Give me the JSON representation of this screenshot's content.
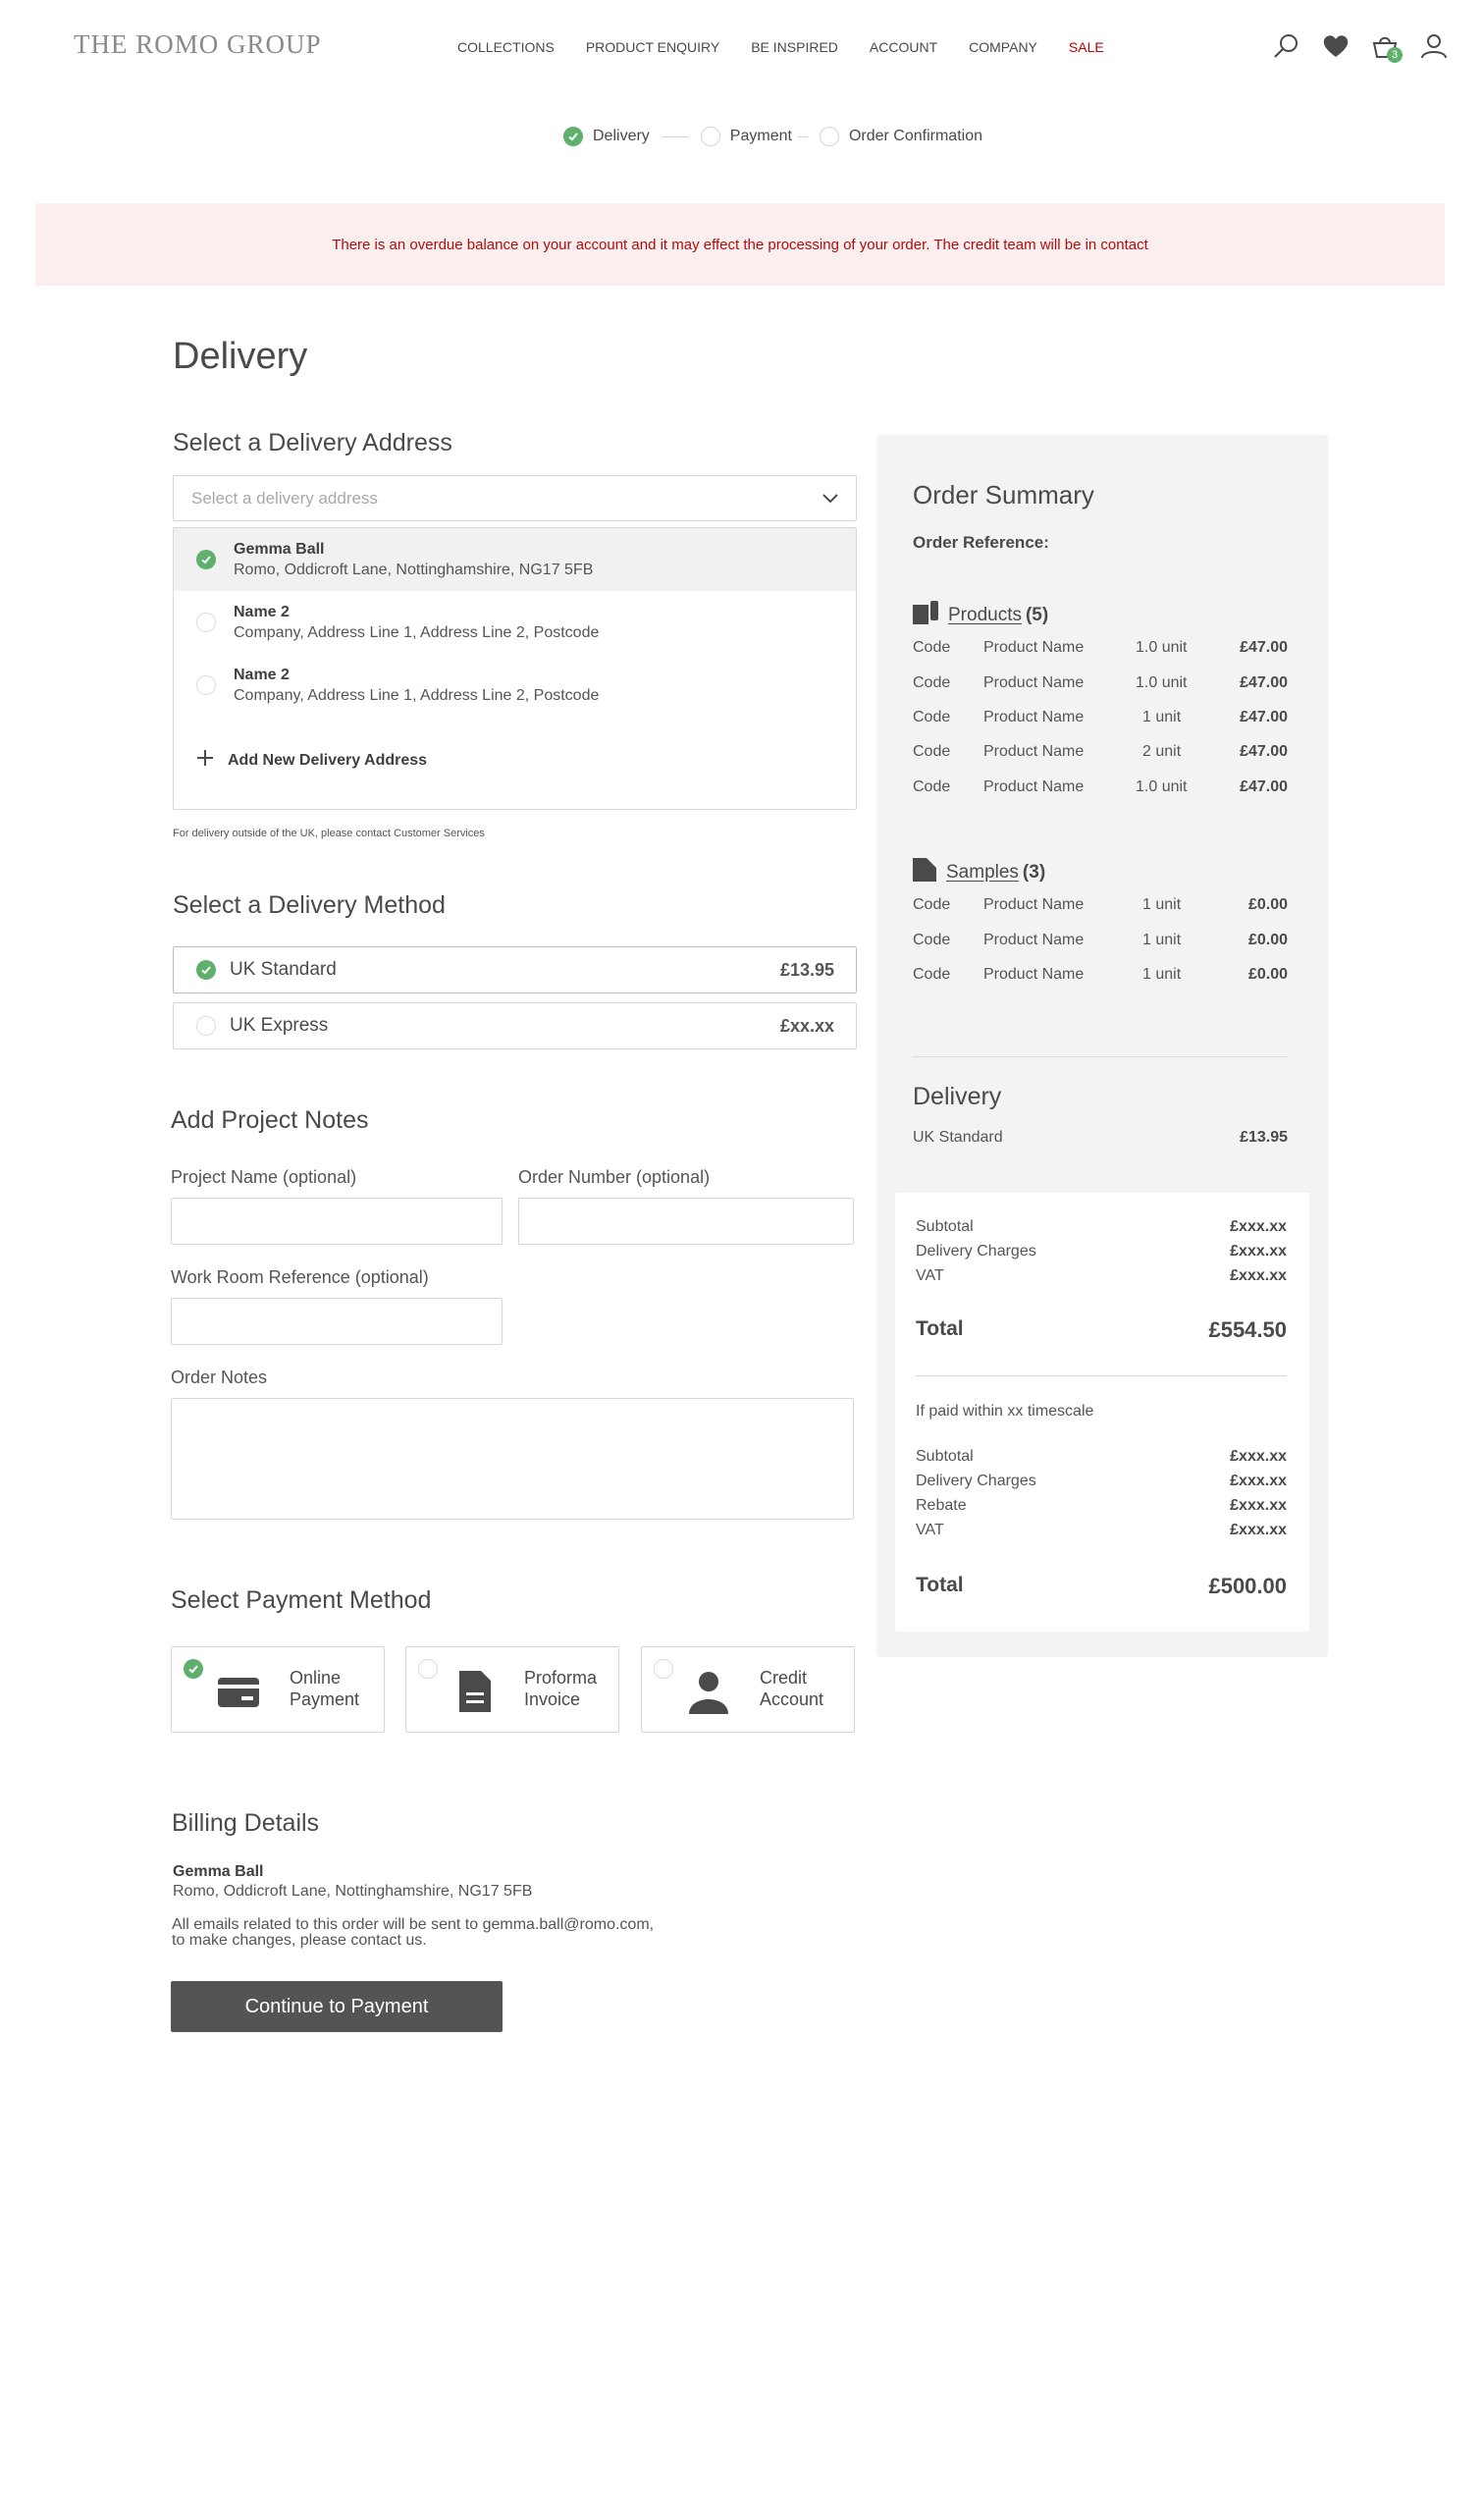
{
  "header": {
    "logo": "THE ROMO GROUP",
    "nav": [
      "COLLECTIONS",
      "PRODUCT ENQUIRY",
      "BE INSPIRED",
      "ACCOUNT",
      "COMPANY",
      "SALE"
    ],
    "cart_count": "3"
  },
  "steps": [
    "Delivery",
    "Payment",
    "Order Confirmation"
  ],
  "alert": "There is an overdue balance on your account and it may effect the processing of your order. The credit team will be in contact",
  "page_title": "Delivery",
  "address": {
    "heading": "Select a Delivery Address",
    "placeholder": "Select a delivery address",
    "options": [
      {
        "name": "Gemma Ball",
        "line": "Romo, Oddicroft Lane, Nottinghamshire, NG17 5FB"
      },
      {
        "name": "Name 2",
        "line": "Company, Address Line 1, Address Line 2, Postcode"
      },
      {
        "name": "Name 2",
        "line": "Company, Address Line 1, Address Line 2, Postcode"
      }
    ],
    "add_new": "Add New Delivery Address",
    "note": "For delivery outside of the UK, please contact Customer Services"
  },
  "method": {
    "heading": "Select a Delivery Method",
    "options": [
      {
        "label": "UK Standard",
        "price": "£13.95"
      },
      {
        "label": "UK Express",
        "price": "£xx.xx"
      }
    ]
  },
  "notes": {
    "heading": "Add Project Notes",
    "project_name": "Project Name (optional)",
    "order_number": "Order Number (optional)",
    "work_room": "Work Room Reference (optional)",
    "order_notes": "Order Notes"
  },
  "payment": {
    "heading": "Select Payment Method",
    "options": [
      {
        "line1": "Online",
        "line2": "Payment"
      },
      {
        "line1": "Proforma",
        "line2": "Invoice"
      },
      {
        "line1": "Credit",
        "line2": "Account"
      }
    ]
  },
  "billing": {
    "heading": "Billing Details",
    "name": "Gemma Ball",
    "address": "Romo, Oddicroft Lane, Nottinghamshire, NG17 5FB",
    "email_line1": "All emails related to this order will be sent to gemma.ball@romo.com,",
    "email_line2": "to make changes, please contact us.",
    "cta": "Continue to Payment"
  },
  "summary": {
    "heading": "Order Summary",
    "order_ref": "Order Reference:",
    "products_label": "Products",
    "products_count": "(5)",
    "products": [
      {
        "code": "Code",
        "name": "Product Name",
        "qty": "1.0 unit",
        "price": "£47.00"
      },
      {
        "code": "Code",
        "name": "Product Name",
        "qty": "1.0 unit",
        "price": "£47.00"
      },
      {
        "code": "Code",
        "name": "Product Name",
        "qty": "1 unit",
        "price": "£47.00"
      },
      {
        "code": "Code",
        "name": "Product Name",
        "qty": "2 unit",
        "price": "£47.00"
      },
      {
        "code": "Code",
        "name": "Product Name",
        "qty": "1.0 unit",
        "price": "£47.00"
      }
    ],
    "samples_label": "Samples",
    "samples_count": "(3)",
    "samples": [
      {
        "code": "Code",
        "name": "Product Name",
        "qty": "1 unit",
        "price": "£0.00"
      },
      {
        "code": "Code",
        "name": "Product Name",
        "qty": "1 unit",
        "price": "£0.00"
      },
      {
        "code": "Code",
        "name": "Product Name",
        "qty": "1 unit",
        "price": "£0.00"
      }
    ],
    "delivery_heading": "Delivery",
    "delivery_label": "UK Standard",
    "delivery_price": "£13.95",
    "totals1": [
      {
        "label": "Subtotal",
        "value": "£xxx.xx"
      },
      {
        "label": "Delivery Charges",
        "value": "£xxx.xx"
      },
      {
        "label": "VAT",
        "value": "£xxx.xx"
      }
    ],
    "total1_label": "Total",
    "total1_value": "£554.50",
    "paid_within": "If paid within xx timescale",
    "totals2": [
      {
        "label": "Subtotal",
        "value": "£xxx.xx"
      },
      {
        "label": "Delivery Charges",
        "value": "£xxx.xx"
      },
      {
        "label": "Rebate",
        "value": "£xxx.xx"
      },
      {
        "label": "VAT",
        "value": "£xxx.xx"
      }
    ],
    "total2_label": "Total",
    "total2_value": "£500.00"
  }
}
